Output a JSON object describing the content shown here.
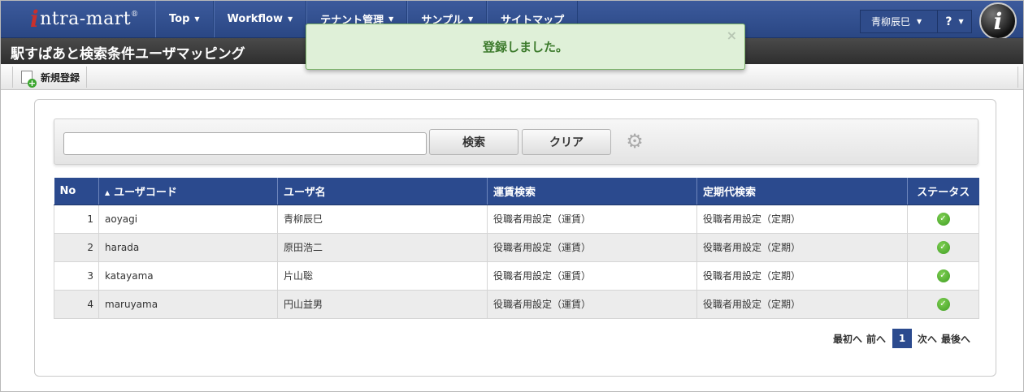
{
  "nav": {
    "logo_text": "ntra-mart",
    "logo_initial": "i",
    "logo_mark": "®",
    "menu": [
      {
        "label": "Top"
      },
      {
        "label": "Workflow"
      },
      {
        "label": "テナント管理"
      },
      {
        "label": "サンプル"
      },
      {
        "label": "サイトマップ"
      }
    ],
    "user_name": "青柳辰巳",
    "help_label": "?",
    "brand_letter": "i"
  },
  "page": {
    "title": "駅すぱあと検索条件ユーザマッピング"
  },
  "toolbar": {
    "new_label": "新規登録"
  },
  "toast": {
    "message": "登録しました。",
    "close": "×"
  },
  "search": {
    "value": "",
    "search_label": "検索",
    "clear_label": "クリア",
    "gear_glyph": "⚙"
  },
  "table": {
    "columns": {
      "no": "No",
      "sort_indicator": "▲",
      "user_code": "ユーザコード",
      "user_name": "ユーザ名",
      "fare_search": "運賃検索",
      "commuter_search": "定期代検索",
      "status": "ステータス"
    },
    "status_glyph": "✓",
    "rows": [
      {
        "no": "1",
        "user_code": "aoyagi",
        "user_name": "青柳辰巳",
        "fare": "役職者用設定（運賃）",
        "commuter": "役職者用設定（定期）"
      },
      {
        "no": "2",
        "user_code": "harada",
        "user_name": "原田浩二",
        "fare": "役職者用設定（運賃）",
        "commuter": "役職者用設定（定期）"
      },
      {
        "no": "3",
        "user_code": "katayama",
        "user_name": "片山聡",
        "fare": "役職者用設定（運賃）",
        "commuter": "役職者用設定（定期）"
      },
      {
        "no": "4",
        "user_code": "maruyama",
        "user_name": "円山益男",
        "fare": "役職者用設定（運賃）",
        "commuter": "役職者用設定（定期）"
      }
    ]
  },
  "pager": {
    "first": "最初へ",
    "prev": "前へ",
    "current": "1",
    "next": "次へ",
    "last": "最後へ"
  },
  "colors": {
    "nav": "#2a4784",
    "header": "#2b4a8e",
    "toast_bg": "#dff0d8",
    "status_ok": "#4caf2a"
  }
}
